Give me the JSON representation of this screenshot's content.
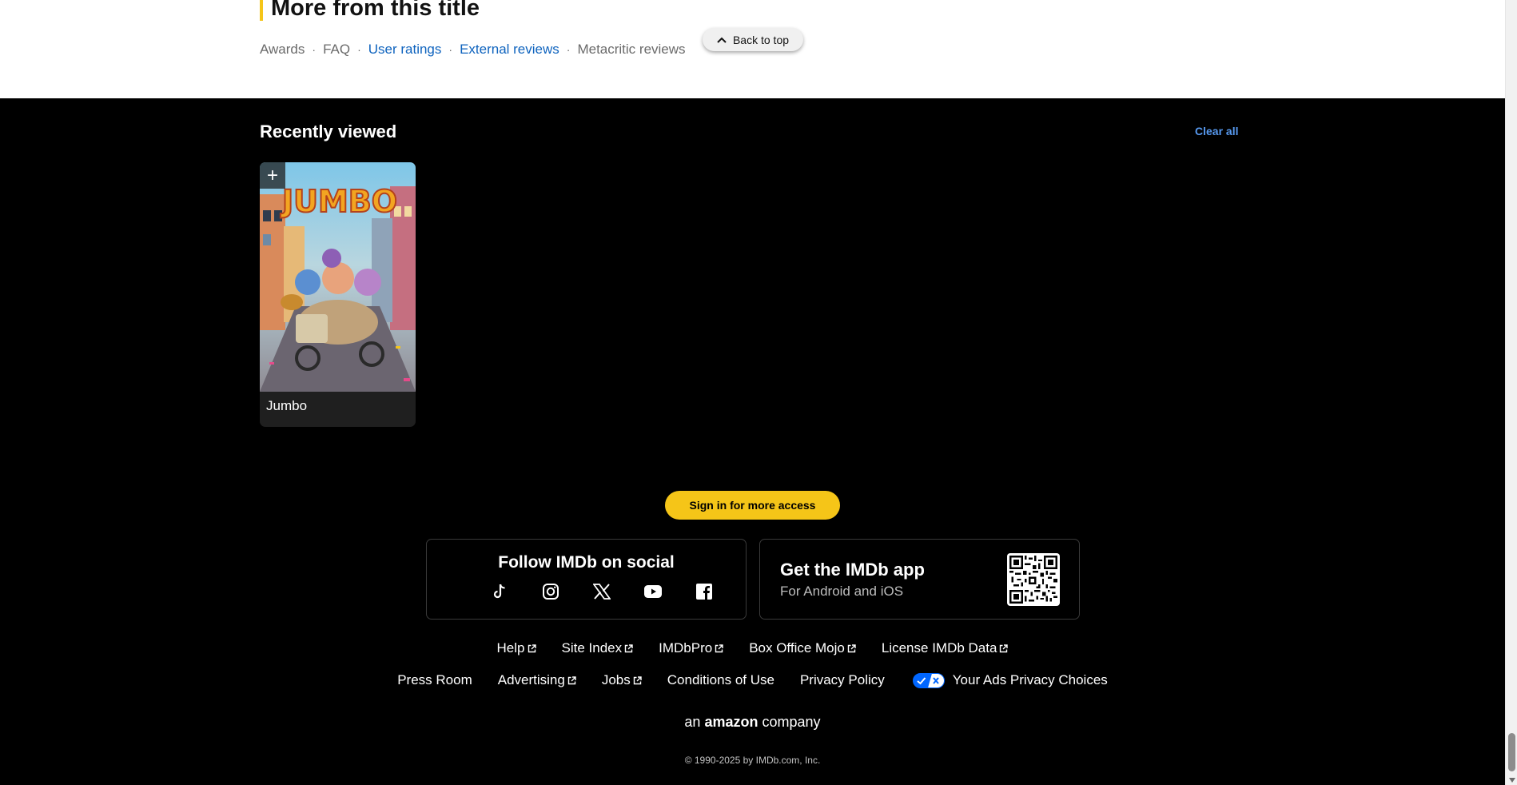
{
  "more_from_title": {
    "heading": "More from this title",
    "links": [
      {
        "label": "Awards",
        "active": false
      },
      {
        "label": "FAQ",
        "active": false
      },
      {
        "label": "User ratings",
        "active": true
      },
      {
        "label": "External reviews",
        "active": true
      },
      {
        "label": "Metacritic reviews",
        "active": false
      }
    ]
  },
  "back_to_top": {
    "label": "Back to top",
    "icon": "chevron-up-icon"
  },
  "recently_viewed": {
    "heading": "Recently viewed",
    "clear_label": "Clear all",
    "items": [
      {
        "title": "Jumbo",
        "poster_title_text": "JUMBO",
        "add_icon": "plus-icon"
      }
    ]
  },
  "footer": {
    "signin_label": "Sign in for more access",
    "social": {
      "heading": "Follow IMDb on social",
      "icons": [
        "tiktok-icon",
        "instagram-icon",
        "x-icon",
        "youtube-icon",
        "facebook-icon"
      ]
    },
    "app": {
      "heading": "Get the IMDb app",
      "subtitle": "For Android and iOS"
    },
    "links_row1": [
      {
        "label": "Help",
        "external": true
      },
      {
        "label": "Site Index",
        "external": true
      },
      {
        "label": "IMDbPro",
        "external": true
      },
      {
        "label": "Box Office Mojo",
        "external": true
      },
      {
        "label": "License IMDb Data",
        "external": true
      }
    ],
    "links_row2": [
      {
        "label": "Press Room",
        "external": false
      },
      {
        "label": "Advertising",
        "external": true
      },
      {
        "label": "Jobs",
        "external": true
      },
      {
        "label": "Conditions of Use",
        "external": false
      },
      {
        "label": "Privacy Policy",
        "external": false
      },
      {
        "label": "Your Ads Privacy Choices",
        "external": false
      }
    ],
    "amazon_prefix": "an",
    "amazon_brand": "amazon",
    "amazon_suffix": "company",
    "copyright": "© 1990-2025 by IMDb.com, Inc."
  },
  "colors": {
    "accent_yellow": "#f5c518",
    "link_blue": "#0e63be",
    "clear_blue": "#5799ef"
  }
}
